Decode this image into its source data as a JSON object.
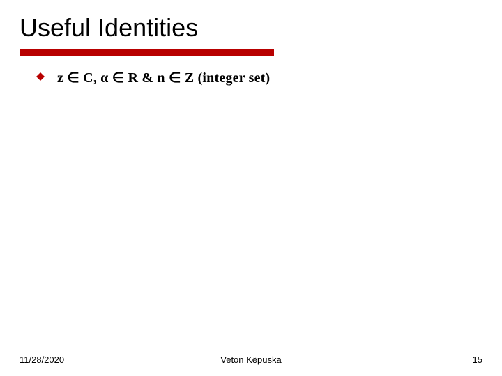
{
  "slide": {
    "title": "Useful Identities",
    "bullet": {
      "text": "z ∈ C, α ∈ R & n ∈ Z (integer set)"
    }
  },
  "footer": {
    "date": "11/28/2020",
    "author": "Veton Këpuska",
    "page": "15"
  },
  "colors": {
    "accent_red": "#b80000",
    "rule_gray": "#b7b7b7"
  }
}
